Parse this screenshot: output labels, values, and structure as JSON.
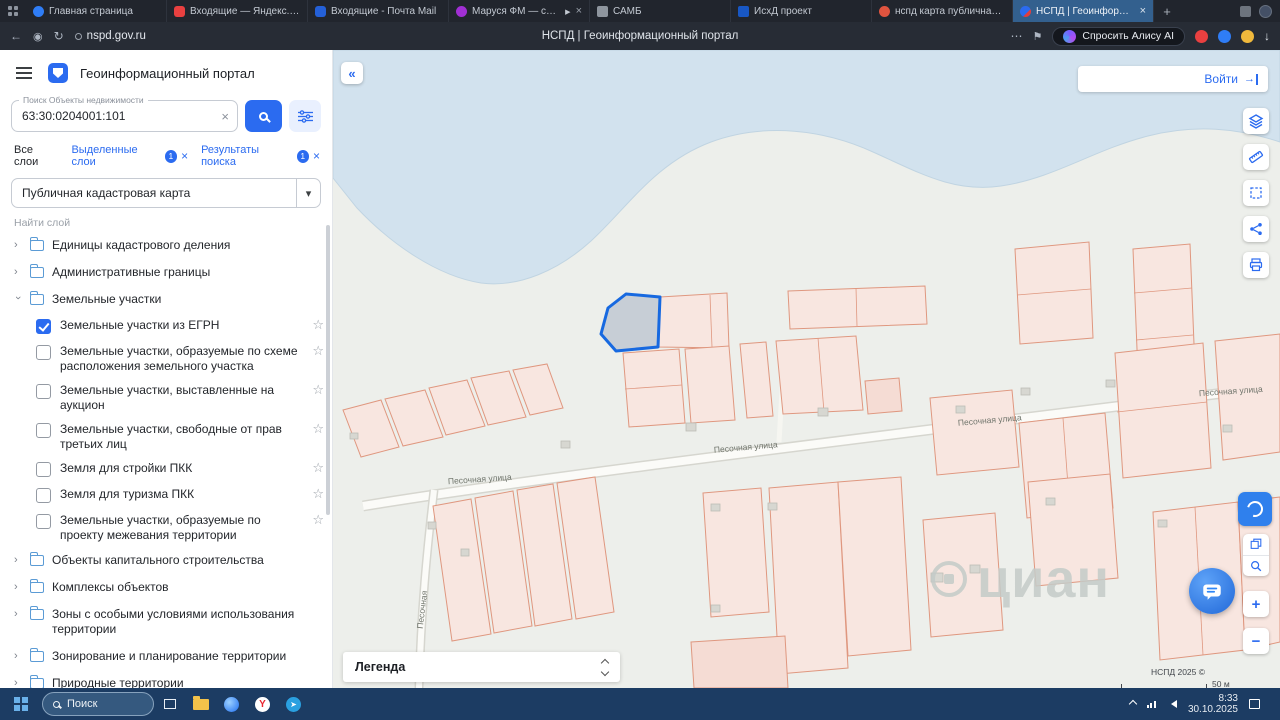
{
  "browser": {
    "tabs": [
      {
        "title": "Главная страница"
      },
      {
        "title": "Входящие — Яндекс.П…"
      },
      {
        "title": "Входящие - Почта Mail"
      },
      {
        "title": "Маруся ФМ — слу…"
      },
      {
        "title": "САМБ"
      },
      {
        "title": "ИсхД проект"
      },
      {
        "title": "нспд карта публичная к…"
      },
      {
        "title": "НСПД | Геоинформац…"
      }
    ],
    "address": {
      "url": "nspd.gov.ru",
      "page_title": "НСПД | Геоинформационный портал",
      "alice_label": "Спросить Алису AI"
    }
  },
  "portal": {
    "title": "Геоинформационный портал",
    "search_label": "Поиск Объекты недвижимости",
    "search_value": "63:30:0204001:101",
    "tabs": {
      "all": "Все слои",
      "selected": "Выделенные слои",
      "selected_badge": "1",
      "results": "Результаты поиска",
      "results_badge": "1"
    },
    "layer_select": "Публичная кадастровая карта",
    "find_layer": "Найти слой",
    "tree": [
      {
        "label": "Единицы кадастрового деления"
      },
      {
        "label": "Административные границы"
      },
      {
        "label": "Земельные участки",
        "expanded": true
      },
      {
        "label": "Земельные участки из ЕГРН",
        "checked": true
      },
      {
        "label": "Земельные участки, образуемые по схеме расположения земельного участка",
        "checked": false
      },
      {
        "label": "Земельные участки, выставленные на аукцион",
        "checked": false
      },
      {
        "label": "Земельные участки, свободные от прав третьих лиц",
        "checked": false
      },
      {
        "label": "Земля для стройки ПКК",
        "checked": false
      },
      {
        "label": "Земля для туризма ПКК",
        "checked": false
      },
      {
        "label": "Земельные участки, образуемые по проекту межевания территории",
        "checked": false
      },
      {
        "label": "Объекты капитального строительства"
      },
      {
        "label": "Комплексы объектов"
      },
      {
        "label": "Зоны с особыми условиями использования территории"
      },
      {
        "label": "Зонирование и планирование территории"
      },
      {
        "label": "Природные территории"
      }
    ]
  },
  "map": {
    "login": "Войти",
    "street": "Песочная улица",
    "street_vertical": "Песочная",
    "legend": "Легенда",
    "watermark": "циан",
    "attribution": "НСПД 2025 ©",
    "scale": "50 м"
  },
  "taskbar": {
    "search": "Поиск",
    "time": "8:33",
    "date": "30.10.2025"
  }
}
